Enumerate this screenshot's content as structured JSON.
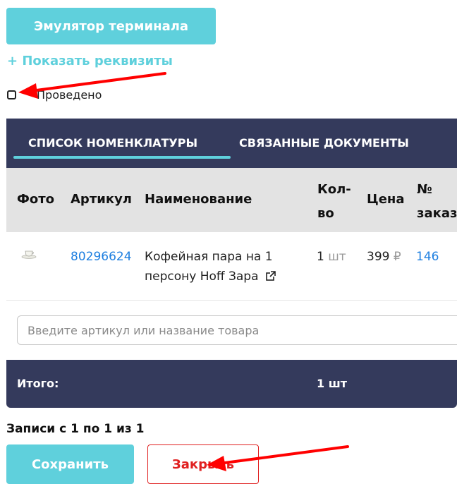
{
  "toolbar": {
    "emulator_label": "Эмулятор терминала"
  },
  "details": {
    "show_link": "+ Показать реквизиты"
  },
  "status": {
    "conducted_label": "Проведено",
    "conducted_checked": false
  },
  "tabs": [
    {
      "label": "СПИСОК НОМЕНКЛАТУРЫ",
      "active": true
    },
    {
      "label": "СВЯЗАННЫЕ ДОКУМЕНТЫ",
      "active": false
    }
  ],
  "table": {
    "columns": {
      "photo": "Фото",
      "article": "Артикул",
      "name": "Наименование",
      "qty_line1": "Кол-",
      "qty_line2": "во",
      "price": "Цена",
      "order_line1": "№",
      "order_line2": "заказ"
    },
    "rows": [
      {
        "photo_icon": "cup-saucer-thumbnail",
        "article": "80296624",
        "name_line1": "Кофейная пара на 1",
        "name_line2": "персону Hoff Зара",
        "external_icon": "external-link-icon",
        "qty_value": "1",
        "qty_unit": "шт",
        "price_value": "399",
        "price_currency": "₽",
        "order": "146"
      }
    ]
  },
  "search": {
    "placeholder": "Введите артикул или название товара",
    "value": ""
  },
  "footer": {
    "total_label": "Итого:",
    "total_qty": "1 шт"
  },
  "pagination": {
    "records_text": "Записи с 1 по 1 из 1"
  },
  "actions": {
    "save_label": "Сохранить",
    "close_label": "Закрыть"
  },
  "colors": {
    "accent": "#5fd0dc",
    "header_bg": "#343a5c",
    "link": "#1e7fe0",
    "danger": "#e02020",
    "annotation_arrow": "#ff0000"
  }
}
